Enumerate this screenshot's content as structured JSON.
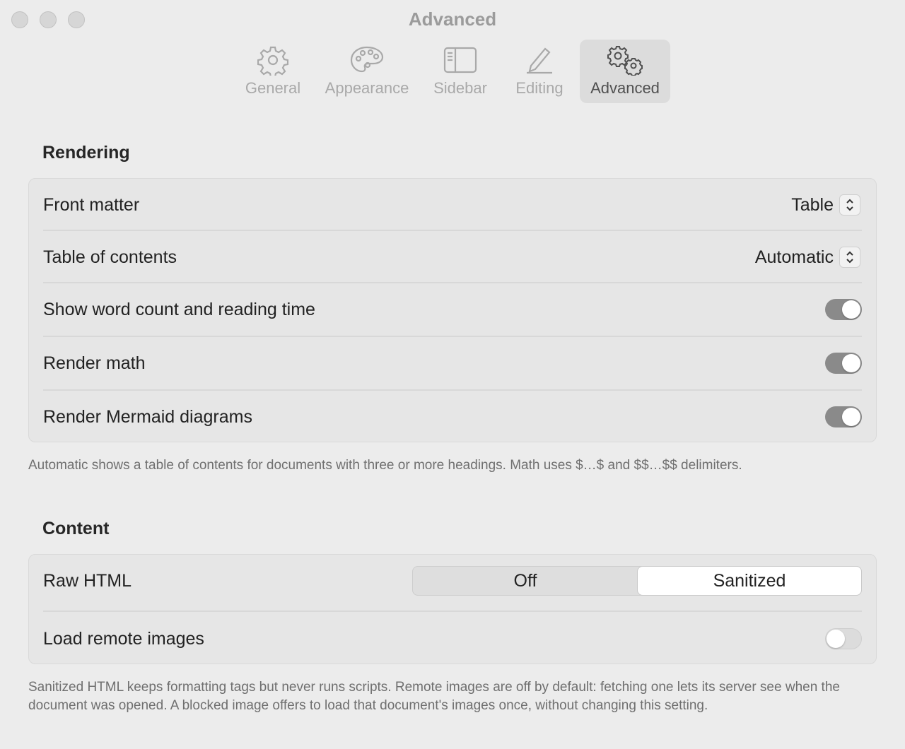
{
  "window": {
    "title": "Advanced"
  },
  "toolbar": {
    "tabs": [
      {
        "label": "General",
        "icon": "gear-icon"
      },
      {
        "label": "Appearance",
        "icon": "palette-icon"
      },
      {
        "label": "Sidebar",
        "icon": "sidebar-icon"
      },
      {
        "label": "Editing",
        "icon": "pencil-icon"
      },
      {
        "label": "Advanced",
        "icon": "gears-icon",
        "active": true
      }
    ]
  },
  "rendering": {
    "title": "Rendering",
    "front_matter": {
      "label": "Front matter",
      "value": "Table"
    },
    "toc": {
      "label": "Table of contents",
      "value": "Automatic"
    },
    "word_count": {
      "label": "Show word count and reading time",
      "on": true
    },
    "render_math": {
      "label": "Render math",
      "on": true
    },
    "mermaid": {
      "label": "Render Mermaid diagrams",
      "on": true
    },
    "note": "Automatic shows a table of contents for documents with three or more headings. Math uses $…$ and $$…$$ delimiters."
  },
  "content": {
    "title": "Content",
    "raw_html": {
      "label": "Raw HTML",
      "options": [
        "Off",
        "Sanitized"
      ],
      "selected": "Sanitized"
    },
    "remote_images": {
      "label": "Load remote images",
      "on": false
    },
    "note": "Sanitized HTML keeps formatting tags but never runs scripts. Remote images are off by default: fetching one lets its server see when the document was opened. A blocked image offers to load that document's images once, without changing this setting."
  },
  "colors": {
    "toggle_on": "#8a8a8a",
    "background": "#ececec",
    "group": "#e6e6e6"
  }
}
